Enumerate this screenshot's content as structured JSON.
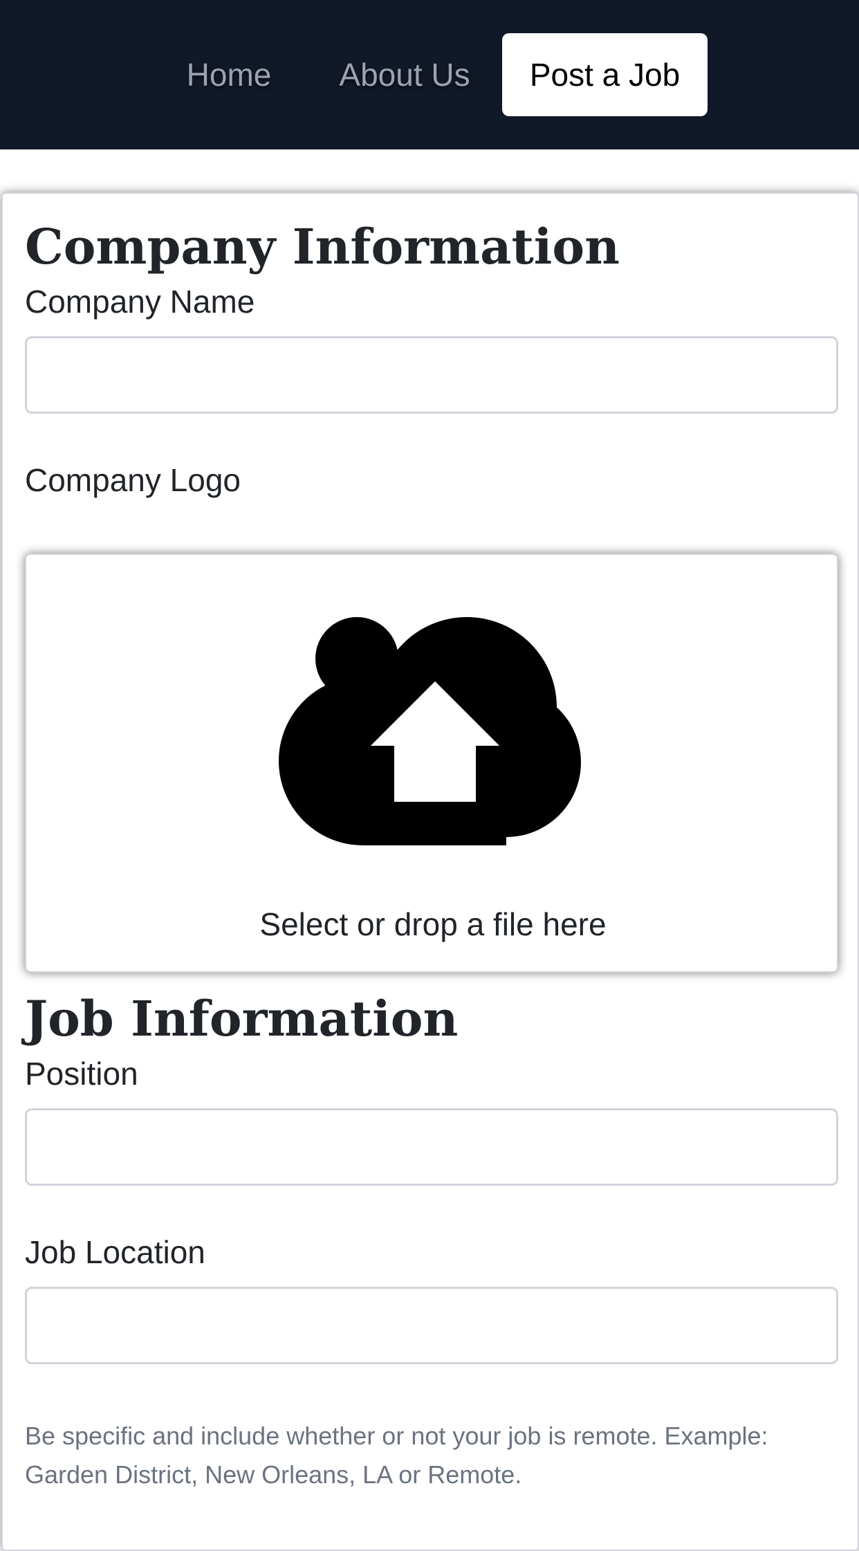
{
  "nav": {
    "home": "Home",
    "about": "About Us",
    "post_job": "Post a Job"
  },
  "company": {
    "heading": "Company Information",
    "name_label": "Company Name",
    "name_value": "",
    "logo_label": "Company Logo",
    "dropzone_text": "Select or drop a file here",
    "dropzone_icon": "cloud-upload-icon"
  },
  "job": {
    "heading": "Job Information",
    "position_label": "Position",
    "position_value": "",
    "location_label": "Job Location",
    "location_value": "",
    "location_help": "Be specific and include whether or not your job is remote. Example: Garden District, New Orleans, LA or Remote."
  },
  "colors": {
    "navbar_bg": "#111827",
    "nav_link": "#9ca3af",
    "active_nav_bg": "#ffffff",
    "help_text": "#6b7280",
    "input_border": "#cfd3da"
  }
}
